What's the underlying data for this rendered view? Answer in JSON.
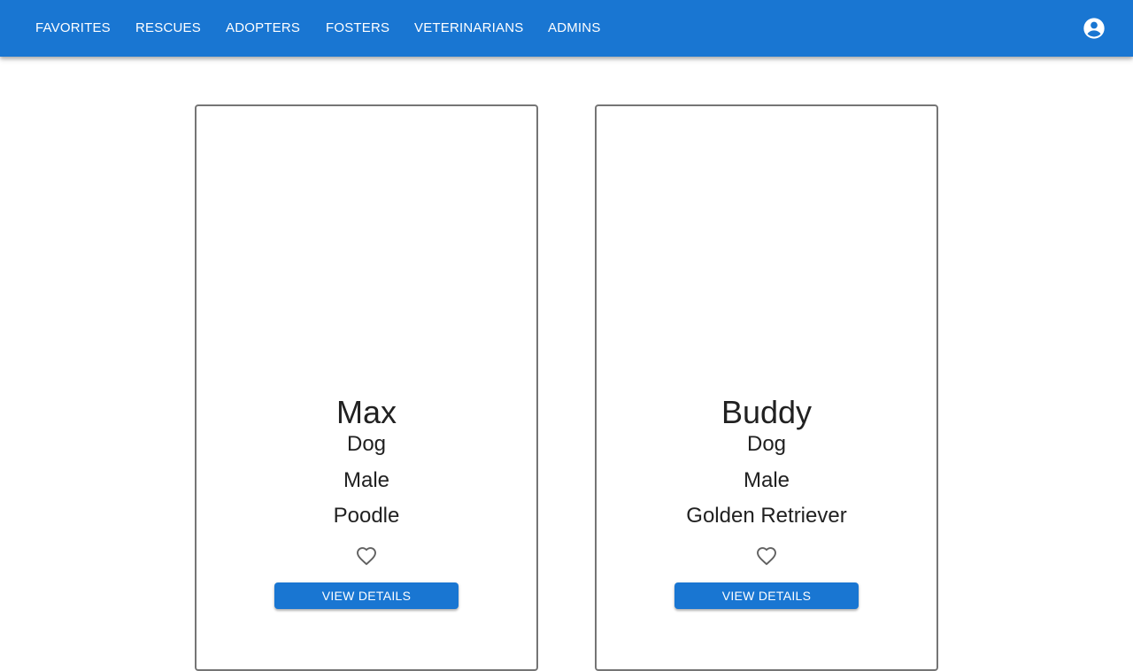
{
  "nav": {
    "items": [
      {
        "label": "FAVORITES"
      },
      {
        "label": "RESCUES"
      },
      {
        "label": "ADOPTERS"
      },
      {
        "label": "FOSTERS"
      },
      {
        "label": "VETERINARIANS"
      },
      {
        "label": "ADMINS"
      }
    ],
    "account_icon": "account-circle-icon"
  },
  "pets": [
    {
      "name": "Max",
      "species": "Dog",
      "sex": "Male",
      "breed": "Poodle",
      "favorite_icon": "heart-outline-icon",
      "details_label": "VIEW DETAILS"
    },
    {
      "name": "Buddy",
      "species": "Dog",
      "sex": "Male",
      "breed": "Golden Retriever",
      "favorite_icon": "heart-outline-icon",
      "details_label": "VIEW DETAILS"
    }
  ],
  "colors": {
    "primary": "#1976d2",
    "card_border": "#757575",
    "text": "#212121",
    "icon": "#616161"
  }
}
